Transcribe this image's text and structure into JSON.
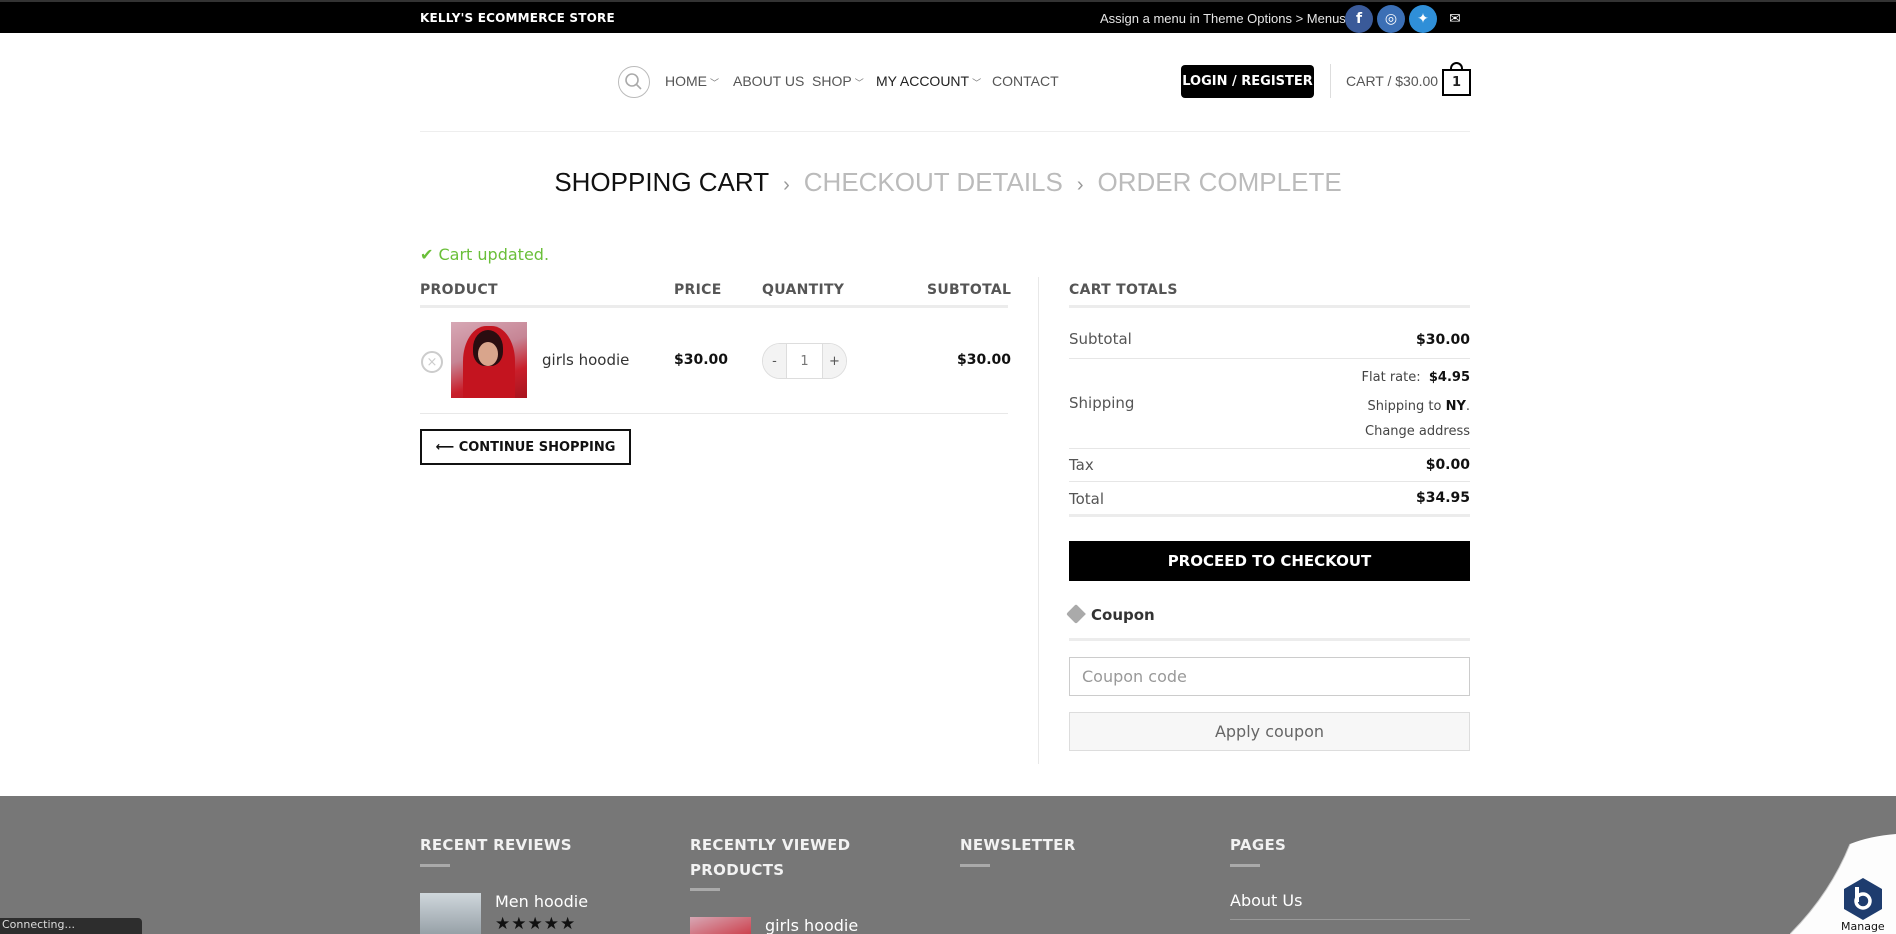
{
  "topbar": {
    "store_name": "KELLY'S ECOMMERCE STORE",
    "menu_note": "Assign a menu in Theme Options > Menus",
    "social": [
      {
        "name": "facebook-icon",
        "glyph": "f"
      },
      {
        "name": "instagram-icon",
        "glyph": "◎"
      },
      {
        "name": "twitter-icon",
        "glyph": "✦"
      },
      {
        "name": "email-icon",
        "glyph": "✉"
      }
    ]
  },
  "nav": {
    "items": [
      {
        "label": "HOME",
        "dropdown": true
      },
      {
        "label": "ABOUT US",
        "dropdown": false
      },
      {
        "label": "SHOP",
        "dropdown": true
      },
      {
        "label": "MY ACCOUNT",
        "dropdown": true
      },
      {
        "label": "CONTACT",
        "dropdown": false
      }
    ],
    "login_label": "LOGIN / REGISTER",
    "cart_label": "CART / $30.00",
    "cart_count": "1"
  },
  "steps": {
    "current": "SHOPPING CART",
    "step2": "CHECKOUT DETAILS",
    "step3": "ORDER COMPLETE"
  },
  "notice": "Cart updated.",
  "cart_table": {
    "headers": {
      "product": "PRODUCT",
      "price": "PRICE",
      "quantity": "QUANTITY",
      "subtotal": "SUBTOTAL"
    },
    "rows": [
      {
        "name": "girls hoodie",
        "price": "$30.00",
        "quantity": "1",
        "subtotal": "$30.00"
      }
    ],
    "qty_minus": "-",
    "qty_plus": "+",
    "continue_label": "⟵ CONTINUE SHOPPING"
  },
  "totals": {
    "title": "CART TOTALS",
    "subtotal_label": "Subtotal",
    "subtotal_value": "$30.00",
    "shipping_label": "Shipping",
    "shipping_method": "Flat rate:",
    "shipping_price": "$4.95",
    "shipping_to_prefix": "Shipping to",
    "shipping_to_state": "NY",
    "change_address": "Change address",
    "tax_label": "Tax",
    "tax_value": "$0.00",
    "total_label": "Total",
    "total_value": "$34.95",
    "checkout_label": "PROCEED TO CHECKOUT",
    "coupon_title": "Coupon",
    "coupon_placeholder": "Coupon code",
    "apply_label": "Apply coupon"
  },
  "footer": {
    "recent_reviews": "RECENT REVIEWS",
    "recently_viewed_line1": "RECENTLY VIEWED",
    "recently_viewed_line2": "PRODUCTS",
    "newsletter": "NEWSLETTER",
    "pages": "PAGES",
    "review_item": "Men hoodie",
    "review_stars": "★★★★★",
    "viewed_item": "girls hoodie",
    "page_item": "About Us"
  },
  "status_text": "Connecting...",
  "manage_label": "Manage"
}
